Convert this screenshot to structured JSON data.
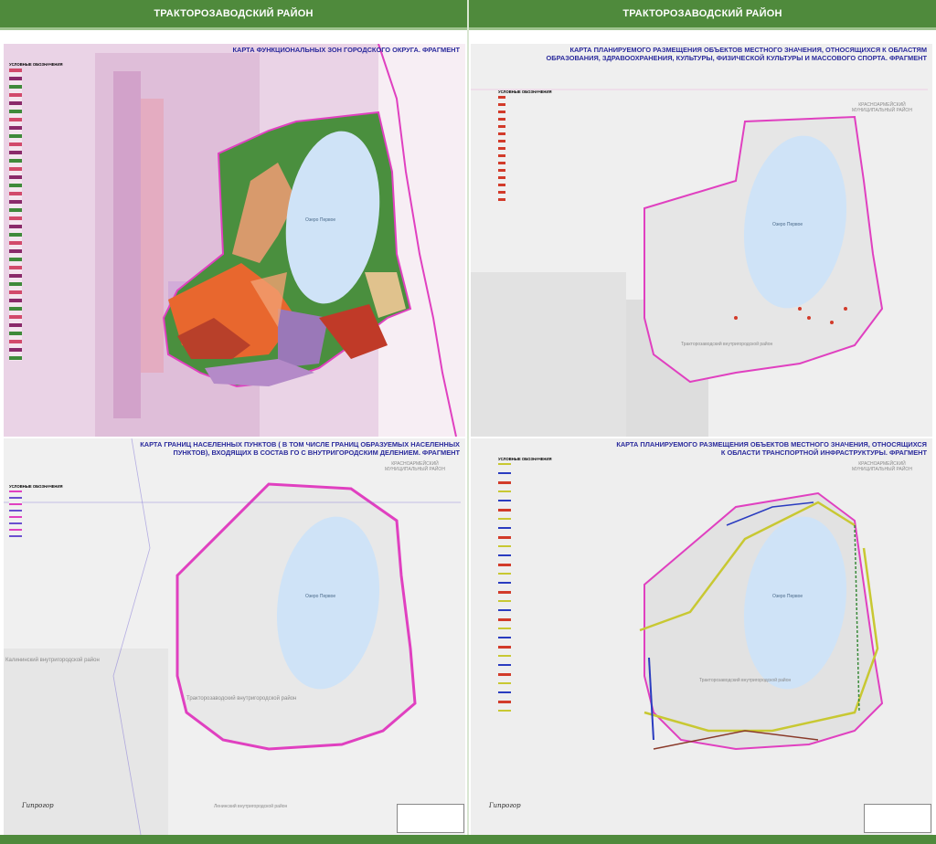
{
  "headers": {
    "left": "ТРАКТОРОЗАВОДСКИЙ РАЙОН",
    "right": "ТРАКТОРОЗАВОДСКИЙ РАЙОН"
  },
  "colors": {
    "header": "#4f8a3c",
    "title_text": "#2a2a9c",
    "boundary": "#e040c0",
    "lake": "#cfe3f7",
    "green_zone": "#3f8a3a"
  },
  "panels": {
    "functional_zones": {
      "title": "КАРТА ФУНКЦИОНАЛЬНЫХ ЗОН ГОРОДСКОГО ОКРУГА. ФРАГМЕНТ",
      "legend_title": "УСЛОВНЫЕ ОБОЗНАЧЕНИЯ",
      "lake_label": "Озеро Первое"
    },
    "social_objects": {
      "title": "КАРТА ПЛАНИРУЕМОГО РАЗМЕЩЕНИЯ ОБЪЕКТОВ МЕСТНОГО ЗНАЧЕНИЯ, ОТНОСЯЩИХСЯ К ОБЛАСТЯМ ОБРАЗОВАНИЯ, ЗДРАВООХРАНЕНИЯ, КУЛЬТУРЫ, ФИЗИЧЕСКОЙ КУЛЬТУРЫ И МАССОВОГО СПОРТА. ФРАГМЕНТ",
      "legend_title": "УСЛОВНЫЕ ОБОЗНАЧЕНИЯ",
      "district_label": "КРАСНОАРМЕЙСКИЙ МУНИЦИПАЛЬНЫЙ РАЙОН",
      "lake_label": "Озеро Первое",
      "area_label": "Тракторозаводский внутригородской район"
    },
    "settlement_borders": {
      "title": "КАРТА ГРАНИЦ НАСЕЛЕННЫХ ПУНКТОВ ( В ТОМ ЧИСЛЕ ГРАНИЦ ОБРАЗУЕМЫХ НАСЕЛЕННЫХ ПУНКТОВ), ВХОДЯЩИХ В СОСТАВ ГО С ВНУТРИГОРОДСКИМ ДЕЛЕНИЕМ. ФРАГМЕНТ",
      "legend_title": "УСЛОВНЫЕ ОБОЗНАЧЕНИЯ",
      "district_label": "КРАСНОАРМЕЙСКИЙ МУНИЦИПАЛЬНЫЙ РАЙОН",
      "lake_label": "Озеро Первое",
      "area_label": "Тракторозаводский внутригородской район",
      "side_label": "Калининский внутригородской район",
      "bottom_label": "Ленинский внутригородской район",
      "logo": "Гипрогор"
    },
    "transport": {
      "title": "КАРТА ПЛАНИРУЕМОГО РАЗМЕЩЕНИЯ ОБЪЕКТОВ МЕСТНОГО ЗНАЧЕНИЯ, ОТНОСЯЩИХСЯ К ОБЛАСТИ ТРАНСПОРТНОЙ ИНФРАСТРУКТУРЫ. ФРАГМЕНТ",
      "legend_title": "УСЛОВНЫЕ ОБОЗНАЧЕНИЯ",
      "district_label": "КРАСНОАРМЕЙСКИЙ МУНИЦИПАЛЬНЫЙ РАЙОН",
      "lake_label": "Озеро Первое",
      "area_label": "Тракторозаводский внутригородской район",
      "logo": "Гипрогор"
    }
  }
}
